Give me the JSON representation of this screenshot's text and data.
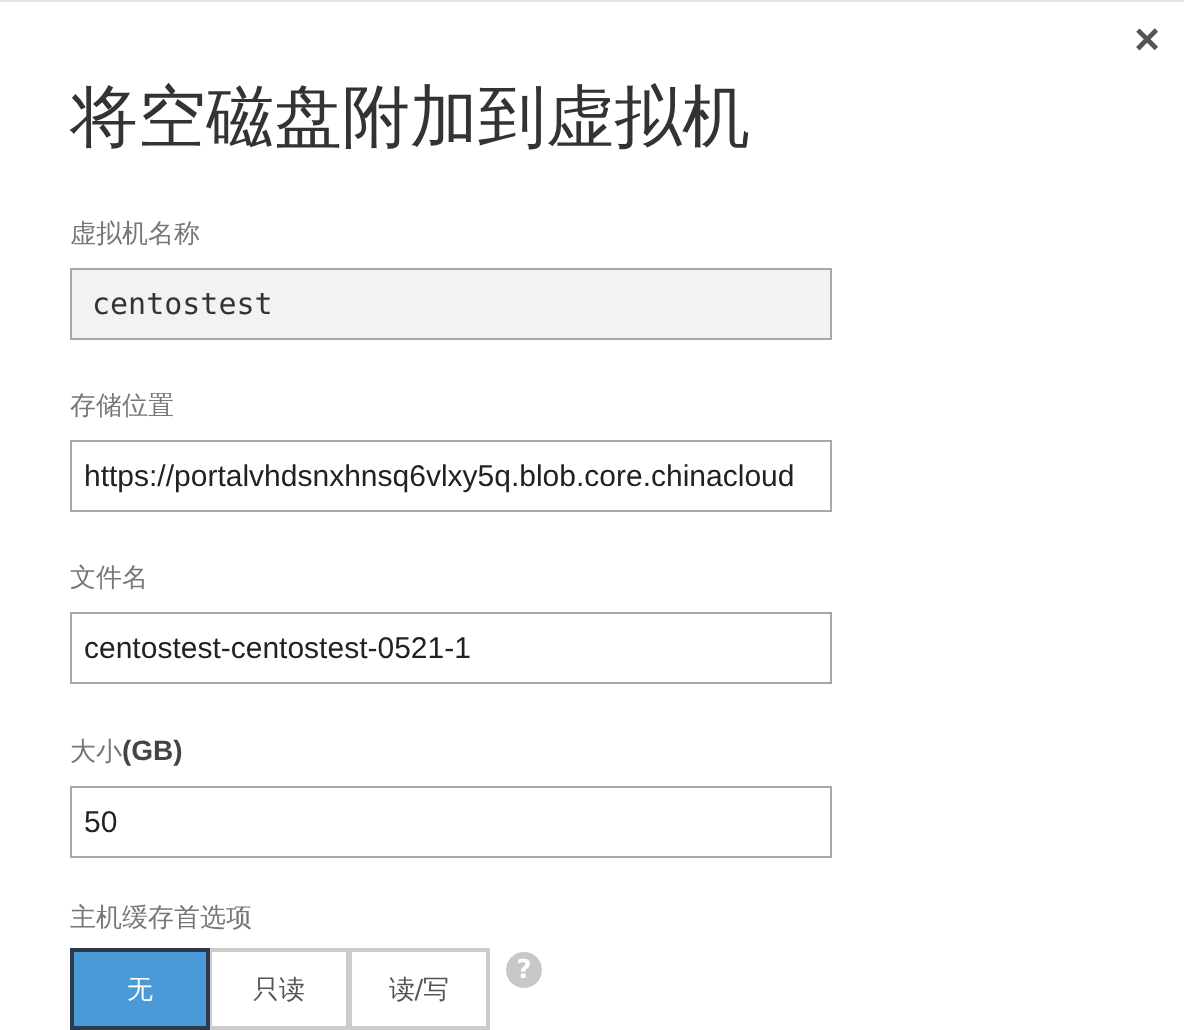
{
  "close": "×",
  "title": "将空磁盘附加到虚拟机",
  "fields": [
    {
      "label": "虚拟机名称",
      "value": "centostest",
      "disabled": true
    },
    {
      "label": "存储位置",
      "value": "https://portalvhdsnxhnsq6vlxy5q.blob.core.chinacloud",
      "disabled": false
    },
    {
      "label": "文件名",
      "value": "centostest-centostest-0521-1",
      "disabled": false
    },
    {
      "label": "大小**(GB)**",
      "value": "50",
      "disabled": false
    }
  ],
  "cache": {
    "label": "主机缓存首选项",
    "options": [
      {
        "label": "无",
        "selected": true
      },
      {
        "label": "只读",
        "selected": false
      },
      {
        "label": "读/写",
        "selected": false
      }
    ],
    "help": "?"
  }
}
